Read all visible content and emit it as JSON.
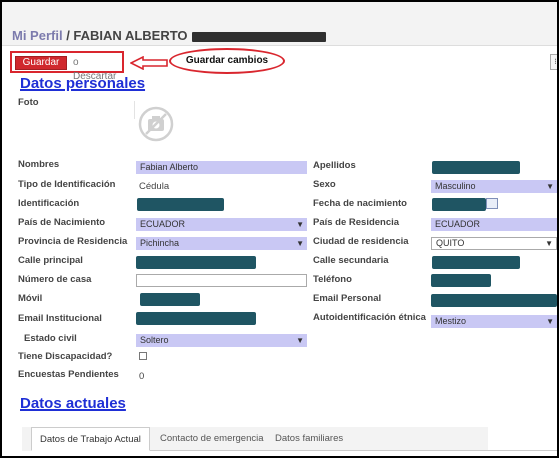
{
  "header": {
    "breadcrumb_link": "Mi Perfil",
    "breadcrumb_sep": " / ",
    "breadcrumb_current": "FABIAN ALBERTO"
  },
  "toolbar": {
    "save_label": "Guardar",
    "discard_label": "o Descartar",
    "callout_text": "Guardar cambios"
  },
  "sections": {
    "personal_title": "Datos personales",
    "current_title": "Datos actuales"
  },
  "labels": {
    "foto": "Foto",
    "nombres": "Nombres",
    "tipo_identificacion": "Tipo de Identificación",
    "identificacion": "Identificación",
    "pais_nacimiento": "País de Nacimiento",
    "provincia_residencia": "Provincia de Residencia",
    "calle_principal": "Calle principal",
    "numero_casa": "Número de casa",
    "movil": "Móvil",
    "email_institucional": "Email Institucional",
    "estado_civil": "Estado civil",
    "tiene_discapacidad": "Tiene Discapacidad?",
    "encuestas_pendientes": "Encuestas Pendientes",
    "apellidos": "Apellidos",
    "sexo": "Sexo",
    "fecha_nacimiento": "Fecha de nacimiento",
    "pais_residencia": "País de Residencia",
    "ciudad_residencia": "Ciudad de residencia",
    "calle_secundaria": "Calle secundaria",
    "telefono": "Teléfono",
    "email_personal": "Email Personal",
    "autoidentificacion": "Autoidentificación étnica"
  },
  "values": {
    "nombres": "Fabian Alberto",
    "tipo_identificacion": "Cédula",
    "pais_nacimiento": "ECUADOR",
    "provincia_residencia": "Pichincha",
    "estado_civil": "Soltero",
    "encuestas_pendientes": "0",
    "sexo": "Masculino",
    "pais_residencia": "ECUADOR",
    "ciudad_residencia": "QUITO",
    "autoidentificacion": "Mestizo"
  },
  "tabs": [
    {
      "label": "Datos de Trabajo Actual"
    },
    {
      "label": "Contacto de emergencia"
    },
    {
      "label": "Datos familiares"
    }
  ],
  "colors": {
    "accent_red": "#d0282d",
    "section_blue": "#1f2fd6",
    "field_lavender": "#c9c8f4",
    "redaction_teal": "#1f5563"
  },
  "icons": {
    "photo_placeholder": "camera-off-icon",
    "calendar": "calendar-icon",
    "dropdown": "caret-down-icon"
  }
}
